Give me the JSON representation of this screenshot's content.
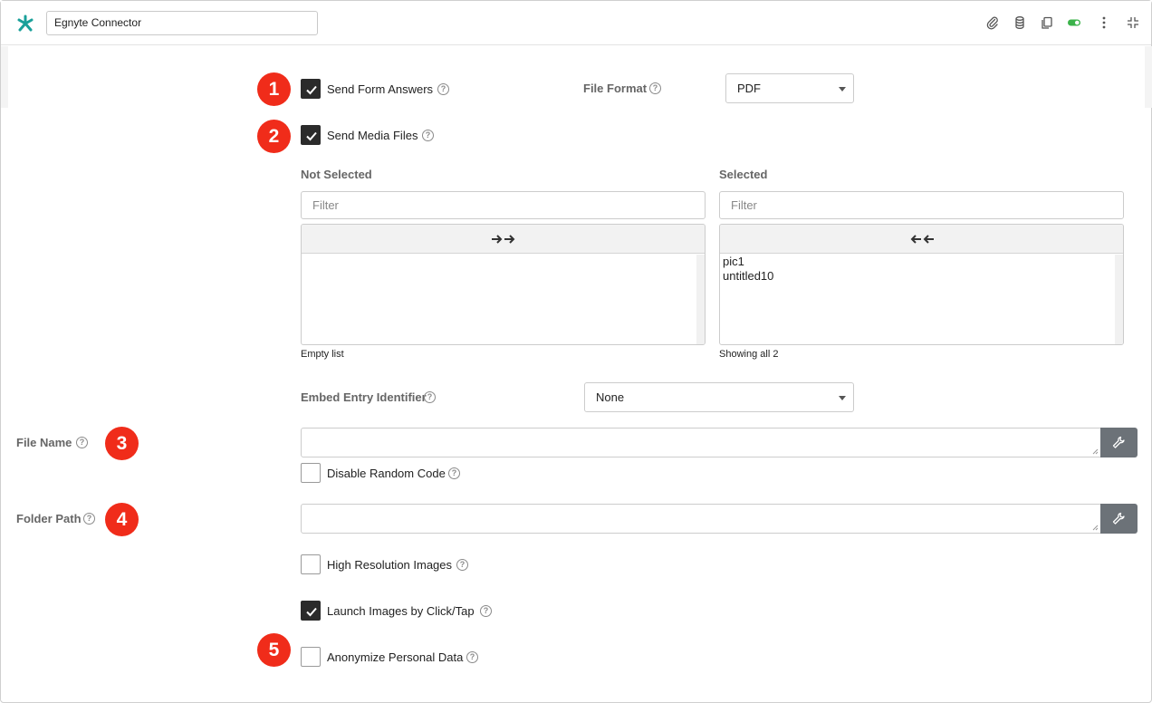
{
  "header": {
    "title_value": "Egnyte Connector",
    "logo_icon": "egnyte-logo",
    "toolbar_icons": [
      "paperclip-icon",
      "database-icon",
      "copy-icon",
      "toggle-on-icon",
      "more-vertical-icon",
      "collapse-icon"
    ],
    "accent_green": "#3bb34a",
    "logo_color": "#1aa09a"
  },
  "badges": [
    "1",
    "2",
    "3",
    "4",
    "5"
  ],
  "send_form_answers": {
    "label": "Send Form Answers",
    "checked": true
  },
  "file_format": {
    "label": "File Format",
    "value": "PDF"
  },
  "send_media_files": {
    "label": "Send Media Files",
    "checked": true
  },
  "dual_list": {
    "not_selected": {
      "header": "Not Selected",
      "filter_placeholder": "Filter",
      "items": [],
      "status": "Empty list"
    },
    "selected": {
      "header": "Selected",
      "filter_placeholder": "Filter",
      "items": [
        "pic1",
        "untitled10"
      ],
      "status": "Showing all 2"
    }
  },
  "embed_entry_identifier": {
    "label": "Embed Entry Identifier",
    "value": "None"
  },
  "file_name": {
    "label": "File Name",
    "value": ""
  },
  "disable_random_code": {
    "label": "Disable Random Code",
    "checked": false
  },
  "folder_path": {
    "label": "Folder Path",
    "value": ""
  },
  "high_resolution_images": {
    "label": "High Resolution Images",
    "checked": false
  },
  "launch_images": {
    "label": "Launch Images by Click/Tap",
    "checked": true
  },
  "anonymize": {
    "label": "Anonymize Personal Data",
    "checked": false
  },
  "colors": {
    "badge": "#f02c1a",
    "checkbox_checked": "#2b2b2b",
    "wrench_button": "#6c7278"
  }
}
